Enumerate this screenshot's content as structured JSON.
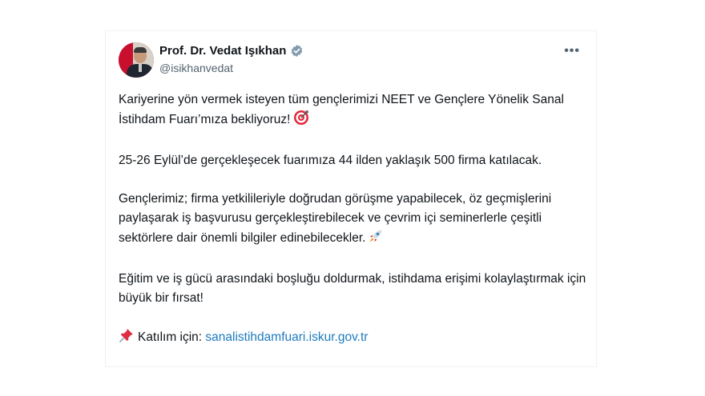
{
  "author": {
    "display_name": "Prof. Dr. Vedat Işıkhan",
    "handle": "@isikhanvedat",
    "verified_icon": "verified-badge-icon"
  },
  "menu": {
    "more_label": "•••"
  },
  "tweet": {
    "p1": "Kariyerine yön vermek isteyen tüm gençlerimizi NEET ve Gençlere Yönelik Sanal İstihdam Fuarı’mıza bekliyoruz!",
    "p1_emoji": "target-icon",
    "p2": "25-26 Eylül’de gerçekleşecek fuarımıza 44 ilden yaklaşık 500 firma katılacak.",
    "p3": "Gençlerimiz; firma yetkilileriyle doğrudan görüşme yapabilecek, öz geçmişlerini paylaşarak iş başvurusu gerçekleştirebilecek ve çevrim içi seminerlerle çeşitli sektörlere dair önemli bilgiler edinebilecekler.",
    "p3_emoji": "rocket-icon",
    "p4": "Eğitim ve iş gücü arasındaki boşluğu doldurmak, istihdama erişimi kolaylaştırmak için büyük bir fırsat!",
    "p5_label": "Katılım için:",
    "p5_emoji": "pushpin-icon",
    "p5_link": "sanalistihdamfuari.iskur.gov.tr"
  },
  "colors": {
    "text": "#0f1419",
    "muted": "#536471",
    "link": "#1d7bbf",
    "verified": "#829aab"
  }
}
